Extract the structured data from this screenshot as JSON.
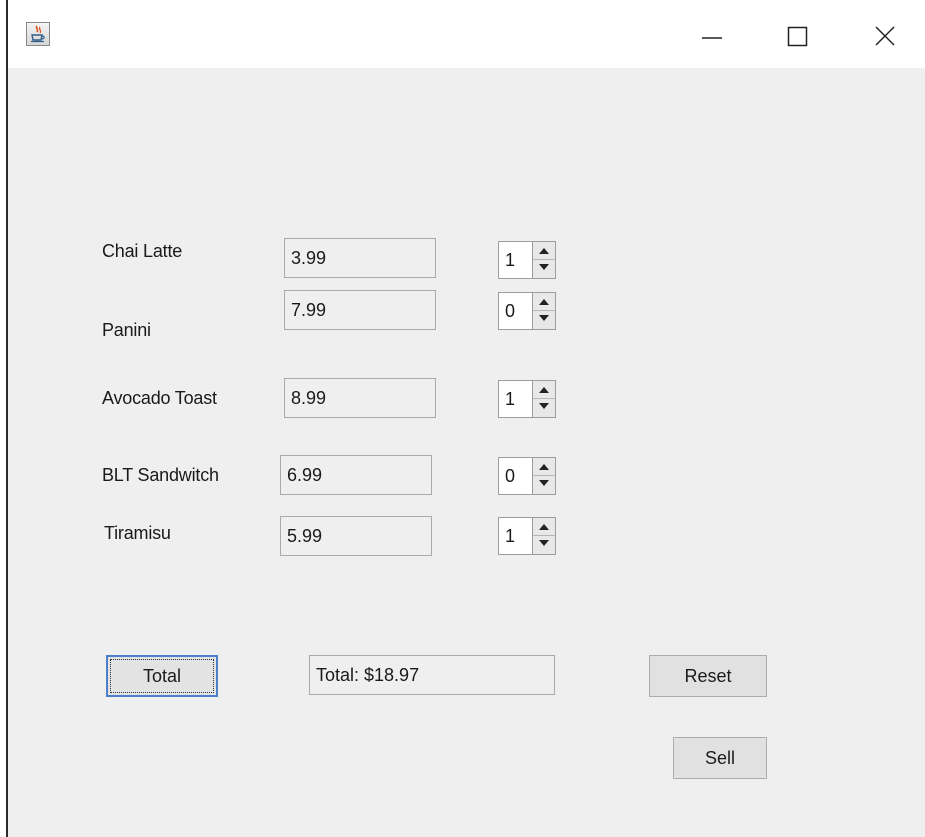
{
  "window": {
    "icon": "java-cup-icon",
    "controls": [
      "minimize-icon",
      "maximize-icon",
      "close-icon"
    ]
  },
  "items": [
    {
      "name": "Chai Latte",
      "price": "3.99",
      "qty": "1"
    },
    {
      "name": "Panini",
      "price": "7.99",
      "qty": "0"
    },
    {
      "name": "Avocado Toast",
      "price": "8.99",
      "qty": "1"
    },
    {
      "name": "BLT Sandwitch",
      "price": "6.99",
      "qty": "0"
    },
    {
      "name": "Tiramisu",
      "price": "5.99",
      "qty": "1"
    }
  ],
  "actions": {
    "total_label": "Total",
    "total_display": "Total: $18.97",
    "reset_label": "Reset",
    "sell_label": "Sell"
  },
  "colors": {
    "background": "#efefef",
    "focus_border": "#4a7fc9"
  }
}
